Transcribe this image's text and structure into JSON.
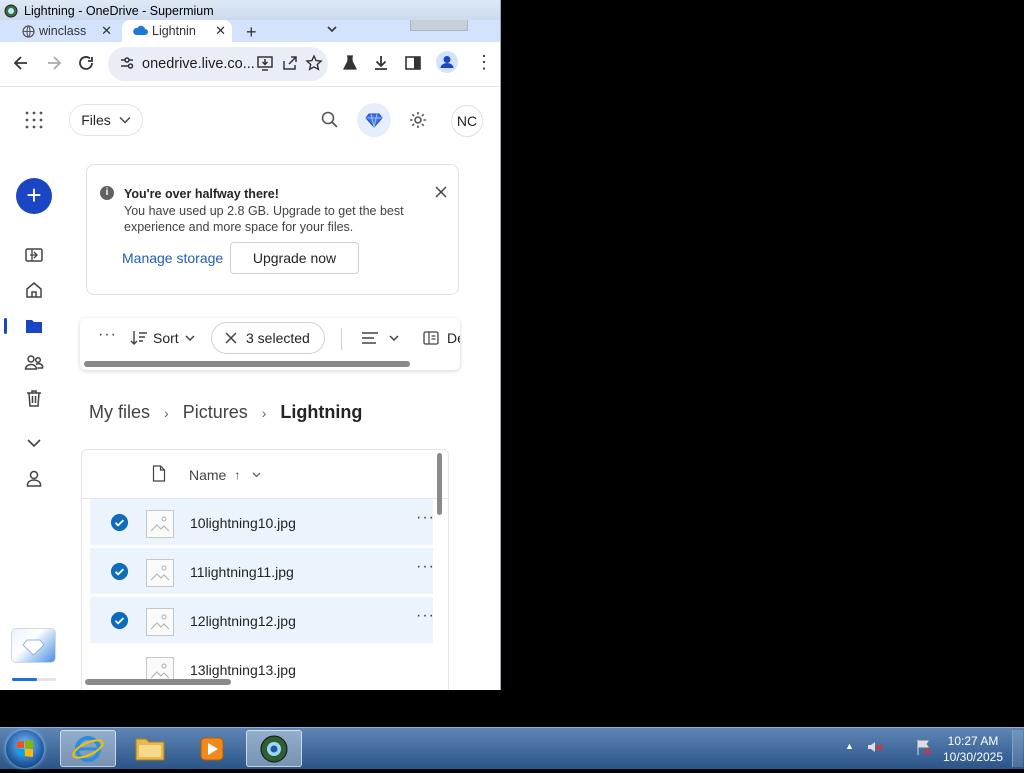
{
  "window": {
    "title": "Lightning - OneDrive - Supermium"
  },
  "tabs": [
    {
      "label": "winclass",
      "active": false
    },
    {
      "label": "Lightnin",
      "active": true
    }
  ],
  "toolbar": {
    "url": "onedrive.live.co..."
  },
  "header": {
    "files_label": "Files",
    "avatar_initials": "NC"
  },
  "notice": {
    "title": "You're over halfway there!",
    "body": "You have used up 2.8 GB. Upgrade to get the best experience and more space for your files.",
    "manage_label": "Manage storage",
    "upgrade_label": "Upgrade now"
  },
  "commandbar": {
    "sort_label": "Sort",
    "selected_label": "3 selected",
    "details_label": "De"
  },
  "breadcrumb": [
    "My files",
    "Pictures",
    "Lightning"
  ],
  "list": {
    "column_name": "Name",
    "sort_indicator": "↑",
    "rows": [
      {
        "name": "10lightning10.jpg",
        "selected": true
      },
      {
        "name": "11lightning11.jpg",
        "selected": true
      },
      {
        "name": "12lightning12.jpg",
        "selected": true
      },
      {
        "name": "13lightning13.jpg",
        "selected": false
      }
    ]
  },
  "storage": {
    "used_fraction": 0.56
  },
  "taskbar": {
    "time": "10:27 AM",
    "date": "10/30/2025"
  },
  "colors": {
    "accent": "#1a46c4",
    "selected_row": "#ebf3fc",
    "check": "#0f6cbd"
  }
}
